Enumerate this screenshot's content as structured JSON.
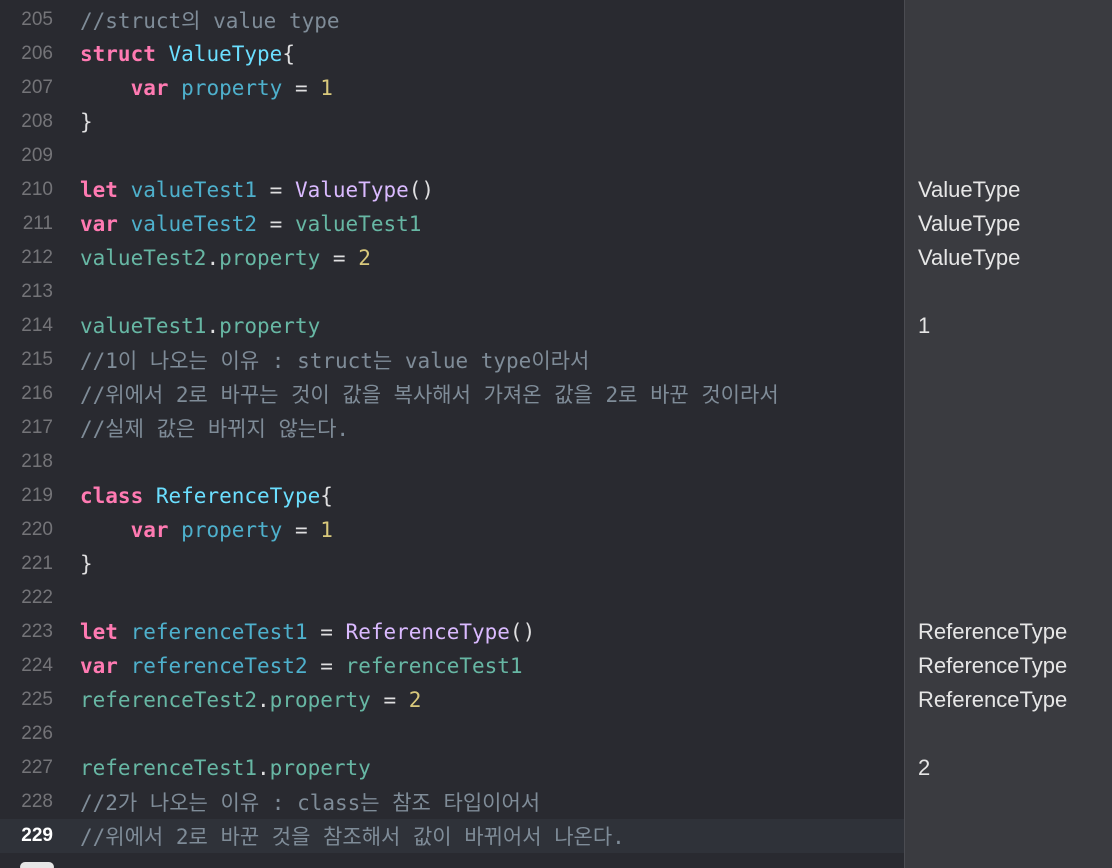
{
  "editor": {
    "lines": [
      {
        "num": "205",
        "tokens": [
          {
            "t": "//struct의 value type",
            "c": "cmt"
          }
        ]
      },
      {
        "num": "206",
        "tokens": [
          {
            "t": "struct",
            "c": "kw"
          },
          {
            "t": " ",
            "c": "pl"
          },
          {
            "t": "ValueType",
            "c": "tn"
          },
          {
            "t": "{",
            "c": "pl"
          }
        ]
      },
      {
        "num": "207",
        "tokens": [
          {
            "t": "    ",
            "c": "pl"
          },
          {
            "t": "var",
            "c": "kw"
          },
          {
            "t": " ",
            "c": "pl"
          },
          {
            "t": "property",
            "c": "vd"
          },
          {
            "t": " = ",
            "c": "pl"
          },
          {
            "t": "1",
            "c": "num"
          }
        ]
      },
      {
        "num": "208",
        "tokens": [
          {
            "t": "}",
            "c": "pl"
          }
        ]
      },
      {
        "num": "209",
        "tokens": []
      },
      {
        "num": "210",
        "tokens": [
          {
            "t": "let",
            "c": "kw"
          },
          {
            "t": " ",
            "c": "pl"
          },
          {
            "t": "valueTest1",
            "c": "vd"
          },
          {
            "t": " = ",
            "c": "pl"
          },
          {
            "t": "ValueType",
            "c": "ti"
          },
          {
            "t": "()",
            "c": "pl"
          }
        ]
      },
      {
        "num": "211",
        "tokens": [
          {
            "t": "var",
            "c": "kw"
          },
          {
            "t": " ",
            "c": "pl"
          },
          {
            "t": "valueTest2",
            "c": "vd"
          },
          {
            "t": " = ",
            "c": "pl"
          },
          {
            "t": "valueTest1",
            "c": "tr"
          }
        ]
      },
      {
        "num": "212",
        "tokens": [
          {
            "t": "valueTest2",
            "c": "tr"
          },
          {
            "t": ".",
            "c": "pl"
          },
          {
            "t": "property",
            "c": "tr"
          },
          {
            "t": " = ",
            "c": "pl"
          },
          {
            "t": "2",
            "c": "num"
          }
        ]
      },
      {
        "num": "213",
        "tokens": []
      },
      {
        "num": "214",
        "tokens": [
          {
            "t": "valueTest1",
            "c": "tr"
          },
          {
            "t": ".",
            "c": "pl"
          },
          {
            "t": "property",
            "c": "tr"
          }
        ]
      },
      {
        "num": "215",
        "tokens": [
          {
            "t": "//1이 나오는 이유 : struct는 value type이라서",
            "c": "cmt"
          }
        ]
      },
      {
        "num": "216",
        "tokens": [
          {
            "t": "//위에서 2로 바꾸는 것이 값을 복사해서 가져온 값을 2로 바꾼 것이라서",
            "c": "cmt"
          }
        ]
      },
      {
        "num": "217",
        "tokens": [
          {
            "t": "//실제 값은 바뀌지 않는다.",
            "c": "cmt"
          }
        ]
      },
      {
        "num": "218",
        "tokens": []
      },
      {
        "num": "219",
        "tokens": [
          {
            "t": "class",
            "c": "kw"
          },
          {
            "t": " ",
            "c": "pl"
          },
          {
            "t": "ReferenceType",
            "c": "tn"
          },
          {
            "t": "{",
            "c": "pl"
          }
        ]
      },
      {
        "num": "220",
        "tokens": [
          {
            "t": "    ",
            "c": "pl"
          },
          {
            "t": "var",
            "c": "kw"
          },
          {
            "t": " ",
            "c": "pl"
          },
          {
            "t": "property",
            "c": "vd"
          },
          {
            "t": " = ",
            "c": "pl"
          },
          {
            "t": "1",
            "c": "num"
          }
        ]
      },
      {
        "num": "221",
        "tokens": [
          {
            "t": "}",
            "c": "pl"
          }
        ]
      },
      {
        "num": "222",
        "tokens": []
      },
      {
        "num": "223",
        "tokens": [
          {
            "t": "let",
            "c": "kw"
          },
          {
            "t": " ",
            "c": "pl"
          },
          {
            "t": "referenceTest1",
            "c": "vd"
          },
          {
            "t": " = ",
            "c": "pl"
          },
          {
            "t": "ReferenceType",
            "c": "ti"
          },
          {
            "t": "()",
            "c": "pl"
          }
        ]
      },
      {
        "num": "224",
        "tokens": [
          {
            "t": "var",
            "c": "kw"
          },
          {
            "t": " ",
            "c": "pl"
          },
          {
            "t": "referenceTest2",
            "c": "vd"
          },
          {
            "t": " = ",
            "c": "pl"
          },
          {
            "t": "referenceTest1",
            "c": "tr"
          }
        ]
      },
      {
        "num": "225",
        "tokens": [
          {
            "t": "referenceTest2",
            "c": "tr"
          },
          {
            "t": ".",
            "c": "pl"
          },
          {
            "t": "property",
            "c": "tr"
          },
          {
            "t": " = ",
            "c": "pl"
          },
          {
            "t": "2",
            "c": "num"
          }
        ]
      },
      {
        "num": "226",
        "tokens": []
      },
      {
        "num": "227",
        "tokens": [
          {
            "t": "referenceTest1",
            "c": "tr"
          },
          {
            "t": ".",
            "c": "pl"
          },
          {
            "t": "property",
            "c": "tr"
          }
        ]
      },
      {
        "num": "228",
        "tokens": [
          {
            "t": "//2가 나오는 이유 : class는 참조 타입이어서",
            "c": "cmt"
          }
        ]
      },
      {
        "num": "229",
        "tokens": [
          {
            "t": "//위에서 2로 바꾼 것을 참조해서 값이 바뀌어서 나온다.",
            "c": "cmt"
          }
        ]
      }
    ],
    "current_line": "229"
  },
  "results": [
    {
      "line": "210",
      "text": "ValueType"
    },
    {
      "line": "211",
      "text": "ValueType"
    },
    {
      "line": "212",
      "text": "ValueType"
    },
    {
      "line": "214",
      "text": "1"
    },
    {
      "line": "223",
      "text": "ReferenceType"
    },
    {
      "line": "224",
      "text": "ReferenceType"
    },
    {
      "line": "225",
      "text": "ReferenceType"
    },
    {
      "line": "227",
      "text": "2"
    }
  ],
  "colors": {
    "editor_bg": "#292a30",
    "results_bg": "#3a3b40",
    "keyword": "#ff7ab2",
    "type_decl": "#6bdfff",
    "type_ref": "#dabaff",
    "var_decl": "#4eb0cc",
    "var_ref": "#67b7a4",
    "number": "#d9c97c",
    "comment": "#7f8c98"
  }
}
